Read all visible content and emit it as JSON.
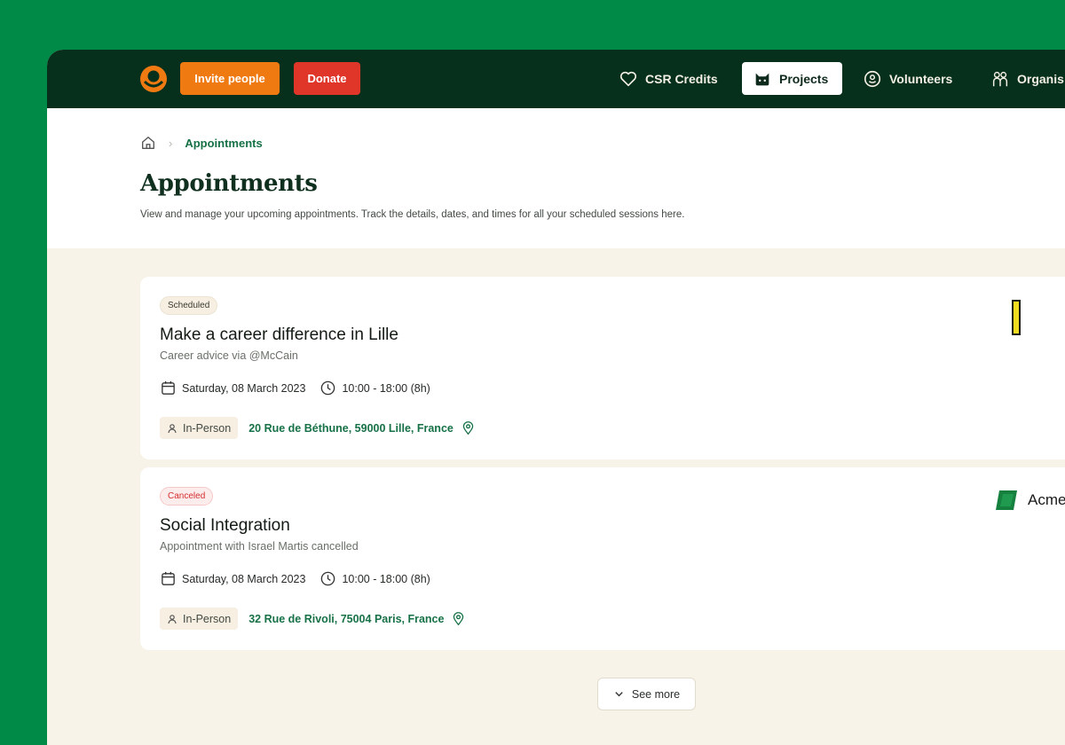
{
  "topnav": {
    "invite_label": "Invite people",
    "donate_label": "Donate",
    "items": [
      {
        "label": "CSR Credits",
        "icon": "heart-icon"
      },
      {
        "label": "Projects",
        "icon": "cat-icon",
        "active": true
      },
      {
        "label": "Volunteers",
        "icon": "smile-icon"
      },
      {
        "label": "Organis",
        "icon": "people-icon"
      }
    ]
  },
  "breadcrumb": {
    "current": "Appointments"
  },
  "page": {
    "title": "Appointments",
    "description": "View and manage your upcoming appointments. Track the details, dates, and times for all your scheduled sessions here."
  },
  "appointments": [
    {
      "status": "Scheduled",
      "title": "Make a career difference in Lille",
      "subtitle": "Career advice via @McCain",
      "date": "Saturday, 08 March 2023",
      "time": "10:00 - 18:00 (8h)",
      "type": "In-Person",
      "address": "20 Rue de Béthune, 59000 Lille, France"
    },
    {
      "status": "Canceled",
      "title": "Social Integration",
      "subtitle": "Appointment with Israel Martis cancelled",
      "date": "Saturday, 08 March 2023",
      "time": "10:00 - 18:00 (8h)",
      "type": "In-Person",
      "address": "32 Rue de Rivoli, 75004 Paris, France",
      "org_name": "Acme"
    }
  ],
  "see_more_label": "See more",
  "colors": {
    "page_bg": "#008a48",
    "nav_bg": "#06301c",
    "invite": "#f07a12",
    "donate": "#e0362a",
    "link_green": "#177146",
    "content_bg": "#f8f3e8"
  }
}
